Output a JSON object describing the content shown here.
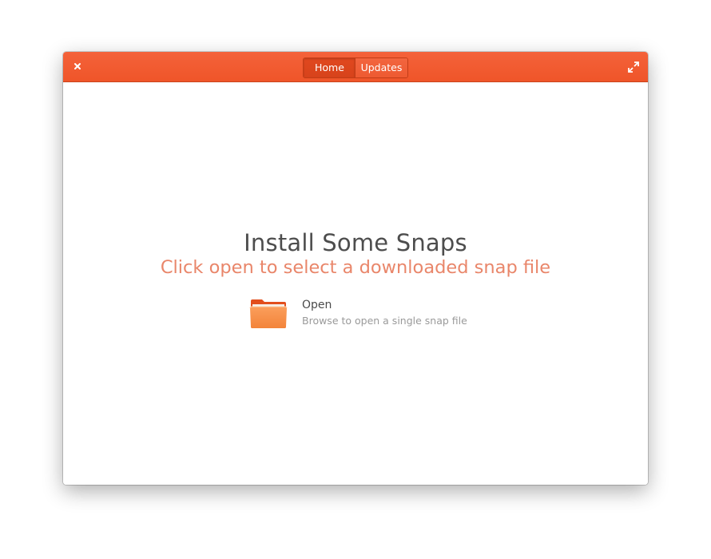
{
  "header": {
    "tabs": [
      {
        "label": "Home",
        "active": true
      },
      {
        "label": "Updates",
        "active": false
      }
    ]
  },
  "main": {
    "title": "Install Some Snaps",
    "subtitle": "Click open to select a downloaded snap file",
    "open_action": {
      "title": "Open",
      "description": "Browse to open a single snap file",
      "icon": "folder-icon"
    }
  },
  "icons": {
    "close": "close-icon",
    "maximize": "maximize-icon"
  },
  "colors": {
    "accent": "#f05a2d",
    "subtitle": "#e9866a",
    "folder": "#f58a3d"
  }
}
